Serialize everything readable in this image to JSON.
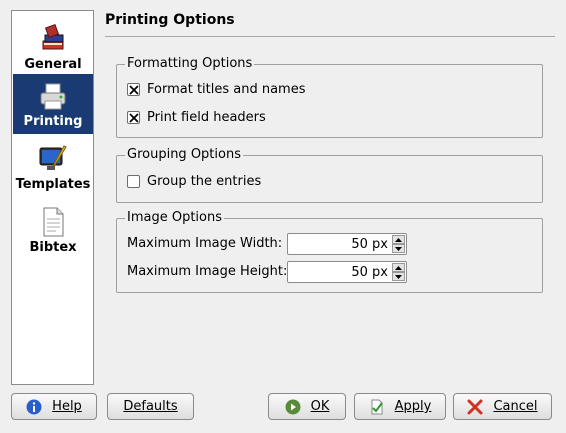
{
  "sidebar": {
    "items": [
      {
        "label": "General",
        "icon": "books-icon"
      },
      {
        "label": "Printing",
        "icon": "printer-icon",
        "selected": true
      },
      {
        "label": "Templates",
        "icon": "monitor-pen-icon"
      },
      {
        "label": "Bibtex",
        "icon": "document-icon"
      }
    ]
  },
  "page": {
    "title": "Printing Options"
  },
  "formatting": {
    "title": "Formatting Options",
    "format_titles": {
      "label": "Format titles and names",
      "checked": true
    },
    "field_headers": {
      "label": "Print field headers",
      "checked": true
    }
  },
  "grouping": {
    "title": "Grouping Options",
    "group_entries": {
      "label": "Group the entries",
      "checked": false
    }
  },
  "image": {
    "title": "Image Options",
    "max_width": {
      "label": "Maximum Image Width:",
      "value": "50 px"
    },
    "max_height": {
      "label": "Maximum Image Height:",
      "value": "50 px"
    }
  },
  "buttons": {
    "help": "Help",
    "defaults": "Defaults",
    "ok": "OK",
    "apply": "Apply",
    "cancel": "Cancel"
  },
  "colors": {
    "selection": "#1a3a73",
    "background": "#efefef"
  }
}
